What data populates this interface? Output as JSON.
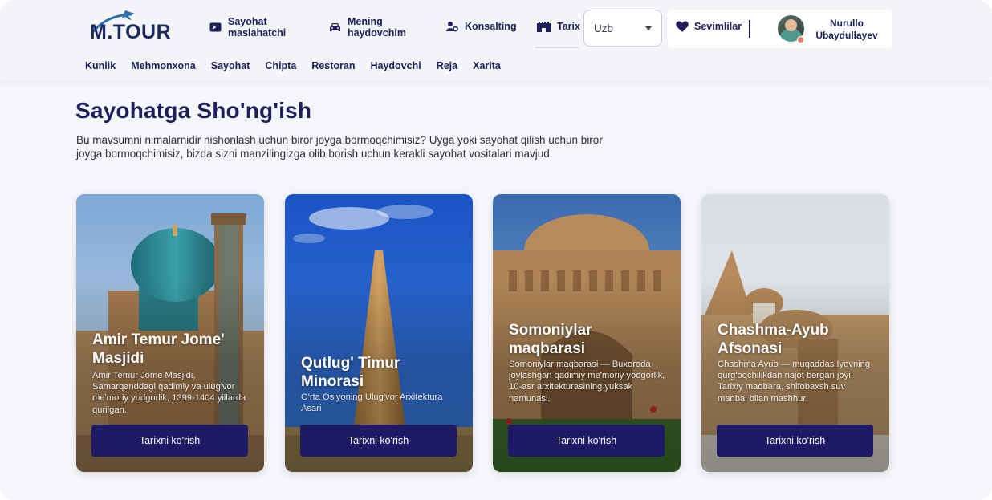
{
  "brand": {
    "logo_text": "M.TOUR"
  },
  "nav": {
    "items": [
      {
        "label": "Sayohat maslahatchi",
        "icon": "ticket-icon"
      },
      {
        "label": "Mening haydovchim",
        "icon": "car-icon"
      },
      {
        "label": "Konsalting",
        "icon": "user-gear-icon"
      },
      {
        "label": "Tarix",
        "icon": "castle-icon"
      }
    ]
  },
  "language": {
    "selected": "Uzb"
  },
  "favorites": {
    "label": "Sevimlilar",
    "icon": "heart-icon"
  },
  "user": {
    "name": "Nurullo Ubaydullayev"
  },
  "subnav": [
    "Kunlik",
    "Mehmonxona",
    "Sayohat",
    "Chipta",
    "Restoran",
    "Haydovchi",
    "Reja",
    "Xarita"
  ],
  "page": {
    "title": "Sayohatga Sho'ng'ish",
    "description": "Bu mavsumni nimalarnidir nishonlash uchun biror joyga bormoqchimisiz? Uyga yoki sayohat qilish uchun biror joyga bormoqchimisiz, bizda sizni manzilingizga olib borish uchun kerakli sayohat vositalari mavjud."
  },
  "cards": [
    {
      "title": "Amir Temur Jome' Masjidi",
      "description": "Amir Temur Jome Masjidi, Samarqanddagi qadimiy va ulug'vor me'moriy yodgorlik, 1399-1404 yillarda qurilgan.",
      "button": "Tarixni ko'rish"
    },
    {
      "title": "Qutlug' Timur Minorasi",
      "description": "O'rta Osiyoning Ulug'vor Arxitektura Asari",
      "button": "Tarixni ko'rish"
    },
    {
      "title": "Somoniylar maqbarasi",
      "description": "Somoniylar maqbarasi — Buxoroda joylashgan qadimiy me'moriy yodgorlik, 10-asr arxitekturasining yuksak namunasi.",
      "button": "Tarixni ko'rish"
    },
    {
      "title": "Chashma-Ayub Afsonasi",
      "description": "Chashma Ayub — muqaddas Iyovning qurg'oqchilikdan najot bergan joyi. Tarixiy maqbara, shifobaxsh suv manbai bilan mashhur.",
      "button": "Tarixni ko'rish"
    }
  ],
  "colors": {
    "primary": "#1f1a66",
    "text": "#1f1d5a",
    "background": "#f5f6fa"
  }
}
